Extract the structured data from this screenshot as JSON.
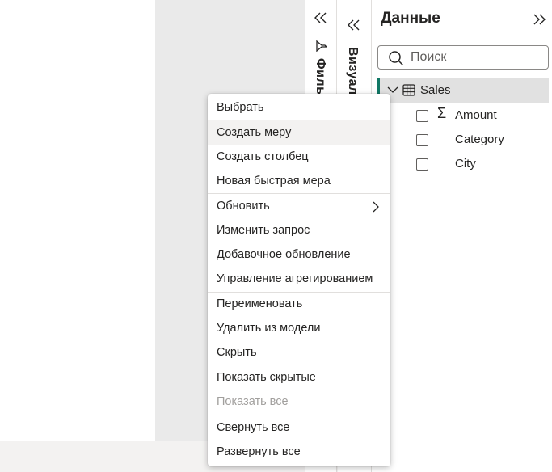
{
  "panes": {
    "filters_label": "Фильтры",
    "visualizations_label": "Визуализации"
  },
  "data_pane": {
    "title": "Данные",
    "search_placeholder": "Поиск",
    "table": {
      "name": "Sales",
      "fields": [
        {
          "label": "Amount",
          "aggregate": true
        },
        {
          "label": "Category",
          "aggregate": false
        },
        {
          "label": "City",
          "aggregate": false
        }
      ]
    }
  },
  "context_menu": {
    "items": [
      {
        "label": "Выбрать"
      },
      {
        "label": "Создать меру",
        "hovered": true
      },
      {
        "label": "Создать столбец"
      },
      {
        "label": "Новая быстрая мера"
      },
      {
        "label": "Обновить",
        "submenu": true
      },
      {
        "label": "Изменить запрос"
      },
      {
        "label": "Добавочное обновление"
      },
      {
        "label": "Управление агрегированием"
      },
      {
        "label": "Переименовать"
      },
      {
        "label": "Удалить из модели"
      },
      {
        "label": "Скрыть"
      },
      {
        "label": "Показать скрытые"
      },
      {
        "label": "Показать все",
        "disabled": true
      },
      {
        "label": "Свернуть все"
      },
      {
        "label": "Развернуть все"
      }
    ]
  },
  "colors": {
    "accent": "#117865",
    "selected_row_bg": "#e1e1e1",
    "menu_hover_bg": "#f3f2f1",
    "disabled_text": "#a19f9d"
  },
  "icons": [
    "double-chevron-left-icon",
    "double-chevron-right-icon",
    "filter-icon",
    "search-icon",
    "chevron-down-icon",
    "table-icon",
    "sigma-icon",
    "chevron-right-icon"
  ]
}
